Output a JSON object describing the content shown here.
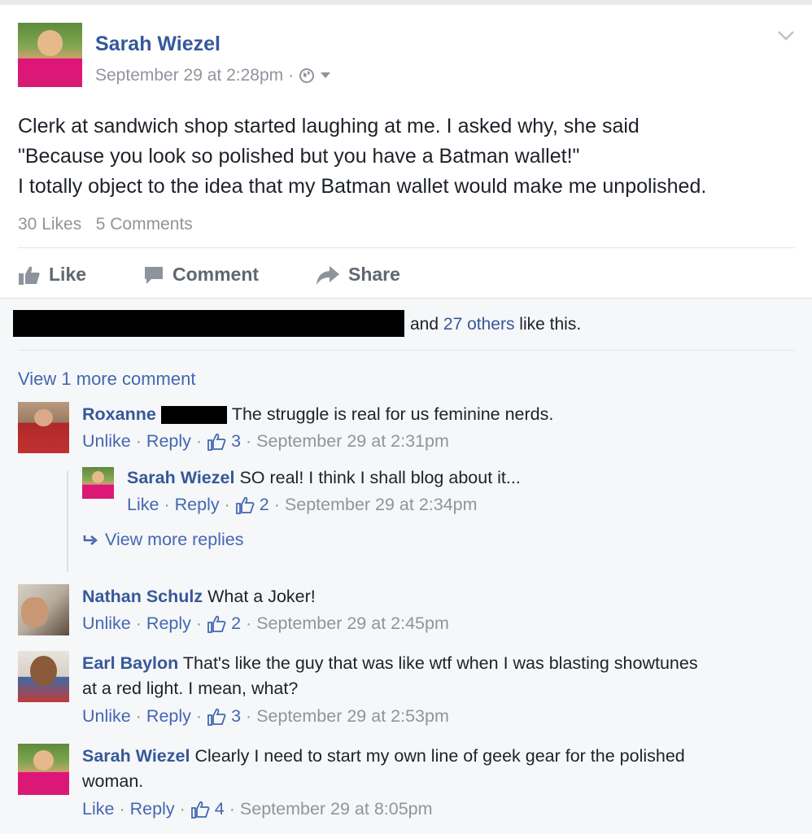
{
  "post": {
    "author": "Sarah Wiezel",
    "timestamp": "September 29 at 2:28pm",
    "meta_separator": "·",
    "text_lines": [
      "Clerk at sandwich shop started laughing at me. I asked why, she said",
      "\"Because you look so polished but you have a Batman wallet!\"",
      "I totally object to the idea that my Batman wallet would make me unpolished."
    ],
    "likes_count": "30 Likes",
    "comments_count": "5 Comments",
    "actions": {
      "like": "Like",
      "comment": "Comment",
      "share": "Share"
    }
  },
  "likes_summary": {
    "and": "and",
    "others": "27 others",
    "suffix": "like this."
  },
  "view_more_comments": "View 1 more comment",
  "comments": [
    {
      "author": "Roxanne",
      "text": "The struggle is real for us feminine nerds.",
      "action1": "Unlike",
      "reply": "Reply",
      "likes": "3",
      "time": "September 29 at 2:31pm"
    },
    {
      "author": "Sarah Wiezel",
      "text": "SO real! I think I shall blog about it...",
      "action1": "Like",
      "reply": "Reply",
      "likes": "2",
      "time": "September 29 at 2:34pm"
    },
    {
      "author": "Nathan Schulz",
      "text": "What a Joker!",
      "action1": "Unlike",
      "reply": "Reply",
      "likes": "2",
      "time": "September 29 at 2:45pm"
    },
    {
      "author": "Earl Baylon",
      "text": "That's like the guy that was like wtf when I was blasting showtunes",
      "text2": "at a red light. I mean, what?",
      "action1": "Unlike",
      "reply": "Reply",
      "likes": "3",
      "time": "September 29 at 2:53pm"
    },
    {
      "author": "Sarah Wiezel",
      "text": "Clearly I need to start my own line of geek gear for the polished",
      "text2": "woman.",
      "action1": "Like",
      "reply": "Reply",
      "likes": "4",
      "time": "September 29 at 8:05pm"
    }
  ],
  "view_more_replies": "View more replies",
  "sep": "·"
}
